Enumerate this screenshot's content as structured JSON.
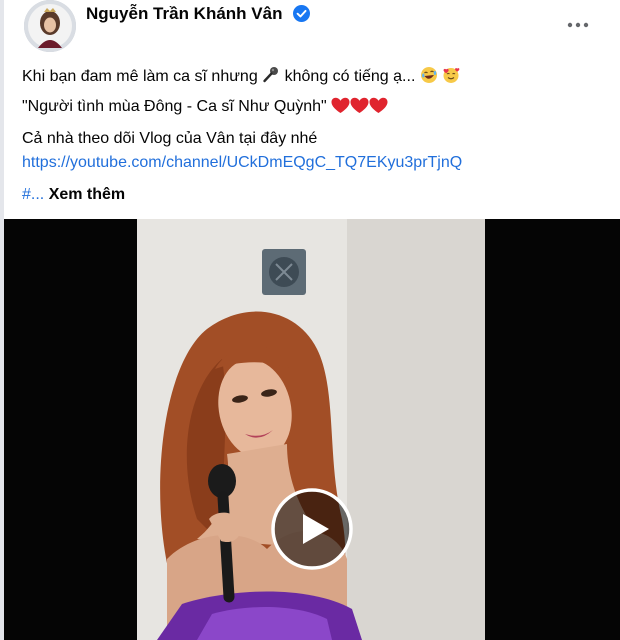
{
  "post": {
    "author": "Nguyễn Trần Khánh Vân",
    "verified": true,
    "icons": {
      "verified": "verified-badge-icon",
      "more": "more-options-icon",
      "mic": "microphone-emoji-icon",
      "laugh": "laughing-emoji-icon",
      "love": "smiling-face-with-hearts-emoji-icon",
      "heart": "red-heart-emoji-icon",
      "play": "play-icon"
    },
    "lines": {
      "line1_a": "Khi bạn đam mê làm ca sĩ nhưng",
      "line1_b": "không có tiếng ạ...",
      "line2": "\"Người tình mùa Đông - Ca sĩ Như Quỳnh\"",
      "line3": "Cả nhà theo dõi Vlog của Vân tại đây nhé",
      "link": "https://youtube.com/channel/UCkDmEQgC_TQ7EKyu3prTjnQ",
      "hashtag": "#...",
      "see_more": "Xem thêm"
    }
  },
  "colors": {
    "link": "#216fdb",
    "verified": "#1877f2",
    "text": "#050505",
    "video_bg": "#050505"
  }
}
